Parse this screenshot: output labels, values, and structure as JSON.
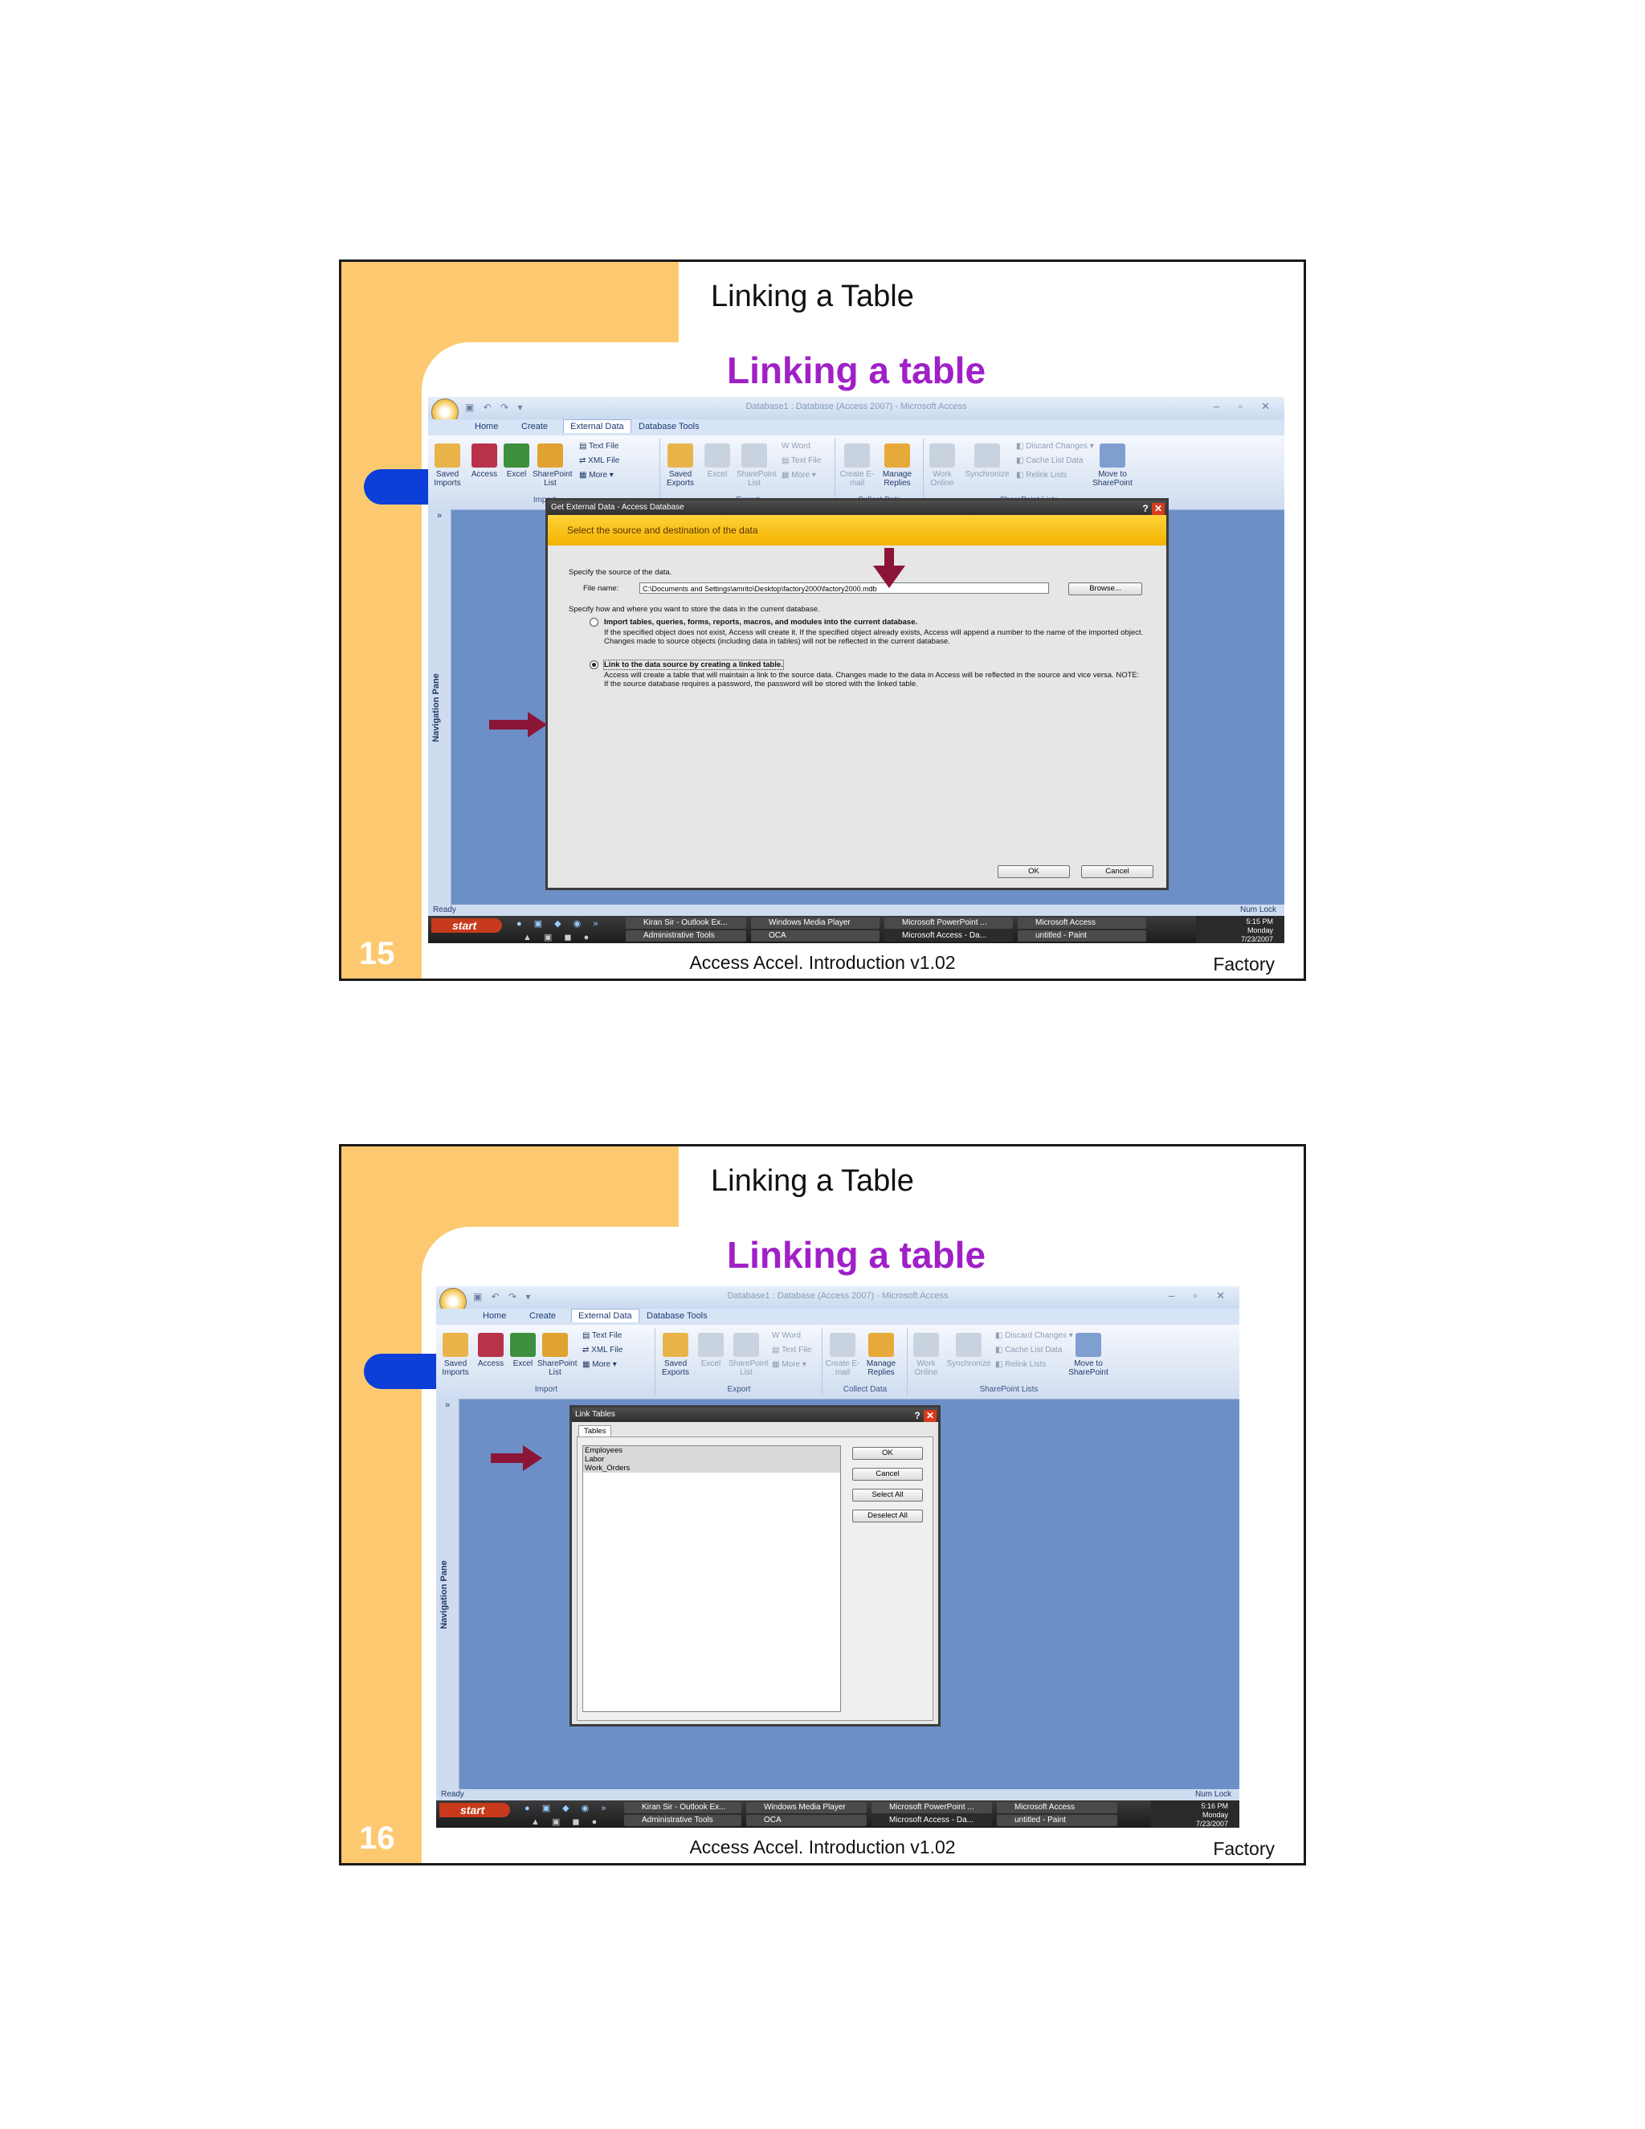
{
  "slides": [
    {
      "title": "Linking a Table",
      "heading": "Linking a table",
      "number": "15",
      "footer": "Access Accel. Introduction v1.02",
      "footer_right": "Factory",
      "app": {
        "window_title": "Database1 : Database (Access 2007) - Microsoft Access",
        "tabs": [
          "Home",
          "Create",
          "External Data",
          "Database Tools"
        ],
        "import_group": {
          "label": "Import",
          "buttons": [
            "Saved Imports",
            "Access",
            "Excel",
            "SharePoint List"
          ],
          "small": [
            "Text File",
            "XML File",
            "More"
          ]
        },
        "export_group": {
          "label": "Export",
          "buttons": [
            "Saved Exports",
            "Excel",
            "SharePoint List"
          ],
          "small": [
            "Word",
            "Text File",
            "More"
          ]
        },
        "collect_group": {
          "label": "Collect Data",
          "buttons": [
            "Create E-mail",
            "Manage Replies"
          ]
        },
        "sharepoint_group": {
          "label": "SharePoint Lists",
          "buttons": [
            "Work Online",
            "Synchronize",
            "Move to SharePoint"
          ],
          "small": [
            "Discard Changes",
            "Cache List Data",
            "Relink Lists"
          ]
        },
        "nav_pane": "Navigation Pane",
        "status_left": "Ready",
        "status_right": "Num Lock",
        "taskbar": {
          "start": "start",
          "tasks_row1": [
            "Kiran Sir - Outlook Ex...",
            "Windows Media Player",
            "Microsoft PowerPoint ...",
            "Microsoft Access"
          ],
          "tasks_row2": [
            "Administrative Tools",
            "OCA",
            "Microsoft Access - Da...",
            "untitled - Paint"
          ],
          "time": "5:15 PM",
          "day": "Monday",
          "date": "7/23/2007"
        }
      },
      "dialog": {
        "title": "Get External Data - Access Database",
        "banner": "Select the source and destination of the data",
        "specify_source": "Specify the source of the data.",
        "file_label": "File name:",
        "file_value": "C:\\Documents and Settings\\amrito\\Desktop\\factory2000\\factory2000.mdb",
        "browse": "Browse...",
        "specify_how": "Specify how and where you want to store the data in the current database.",
        "option1_title": "Import tables, queries, forms, reports, macros, and modules into the current database.",
        "option1_desc": "If the specified object does not exist, Access will create it. If the specified object already exists, Access will append a number to the name of the imported object. Changes made to source objects (including data in tables) will not be reflected in the current database.",
        "option2_title": "Link to the data source by creating a linked table.",
        "option2_desc": "Access will create a table that will maintain a link to the source data. Changes made to the data in Access will be reflected in the source and vice versa. NOTE: If the source database requires a password, the password will be stored with the linked table.",
        "ok": "OK",
        "cancel": "Cancel"
      }
    },
    {
      "title": "Linking a Table",
      "heading": "Linking a table",
      "number": "16",
      "footer": "Access Accel. Introduction v1.02",
      "footer_right": "Factory",
      "app": {
        "window_title": "Database1 : Database (Access 2007) - Microsoft Access",
        "tabs": [
          "Home",
          "Create",
          "External Data",
          "Database Tools"
        ],
        "nav_pane": "Navigation Pane",
        "status_left": "Ready",
        "status_right": "Num Lock",
        "taskbar": {
          "start": "start",
          "tasks_row1": [
            "Kiran Sir - Outlook Ex...",
            "Windows Media Player",
            "Microsoft PowerPoint ...",
            "Microsoft Access"
          ],
          "tasks_row2": [
            "Administrative Tools",
            "OCA",
            "Microsoft Access - Da...",
            "untitled - Paint"
          ],
          "time": "5:16 PM",
          "day": "Monday",
          "date": "7/23/2007"
        }
      },
      "dialog": {
        "title": "Link Tables",
        "tab": "Tables",
        "items": [
          "Employees",
          "Labor",
          "Work_Orders"
        ],
        "ok": "OK",
        "cancel": "Cancel",
        "select_all": "Select All",
        "deselect_all": "Deselect All"
      }
    }
  ],
  "colors": {
    "accent_band": "#fdc970",
    "heading": "#a020c8",
    "arrow": "#8b1536",
    "pill": "#0b3fd8"
  }
}
